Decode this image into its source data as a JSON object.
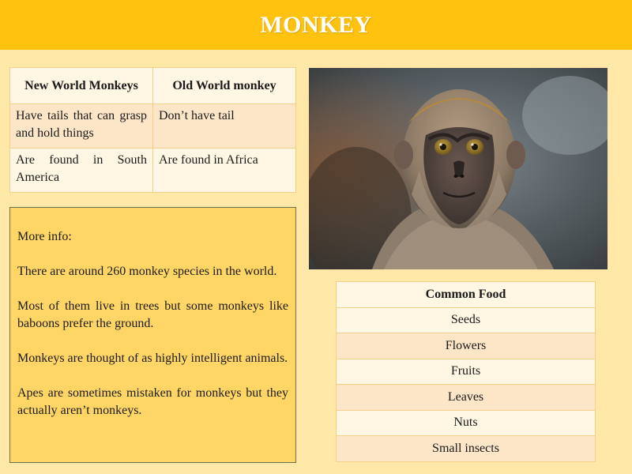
{
  "title": "MONKEY",
  "comparison": {
    "headers": [
      "New World Monkeys",
      "Old World monkey"
    ],
    "rows": [
      [
        "Have tails that can grasp and hold things",
        "Don’t have tail"
      ],
      [
        "Are found in South America",
        "Are found in Africa"
      ]
    ]
  },
  "info": {
    "heading": "More info:",
    "facts": [
      "There are around 260 monkey species in the world.",
      "Most of them live in trees but some monkeys like baboons prefer the ground.",
      "Monkeys are thought of as highly intelligent  animals.",
      "Apes are sometimes mistaken for monkeys but they actually aren’t monkeys."
    ]
  },
  "photo": {
    "subject": "monkey-photo"
  },
  "food": {
    "header": "Common Food",
    "items": [
      "Seeds",
      "Flowers",
      "Fruits",
      "Leaves",
      "Nuts",
      "Small insects"
    ]
  },
  "colors": {
    "background": "#ffe7a8",
    "header_bar": "#ffc20e",
    "info_box": "#ffd666",
    "row_light": "#fff6e3",
    "row_peach": "#fde6c8"
  }
}
